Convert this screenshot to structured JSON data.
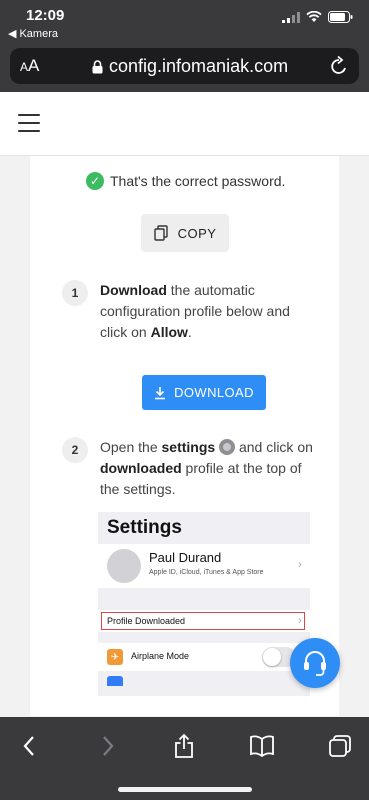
{
  "status_bar": {
    "time": "12:09",
    "back_app": "Kamera"
  },
  "browser": {
    "text_size_label_small": "A",
    "text_size_label_large": "A",
    "url": "config.infomaniak.com"
  },
  "main": {
    "password_ok": "That's the correct password.",
    "copy_label": "COPY",
    "step1": {
      "number": "1",
      "bold1": "Download",
      "text1": " the automatic configuration profile below and click on ",
      "bold2": "Allow",
      "text2": "."
    },
    "download_label": "DOWNLOAD",
    "step2": {
      "number": "2",
      "text1": "Open the ",
      "bold1": "settings",
      "text2": " and click on ",
      "bold2": "downloaded",
      "text3": " profile at the top of the settings."
    },
    "settings_preview": {
      "title": "Settings",
      "name": "Paul Durand",
      "subtitle": "Apple ID, iCloud, iTunes & App Store",
      "profile_downloaded": "Profile Downloaded",
      "airplane_mode": "Airplane Mode"
    }
  },
  "colors": {
    "accent": "#2f8ef5",
    "success": "#3dbb61",
    "browser_chrome": "#3a3a3c"
  }
}
